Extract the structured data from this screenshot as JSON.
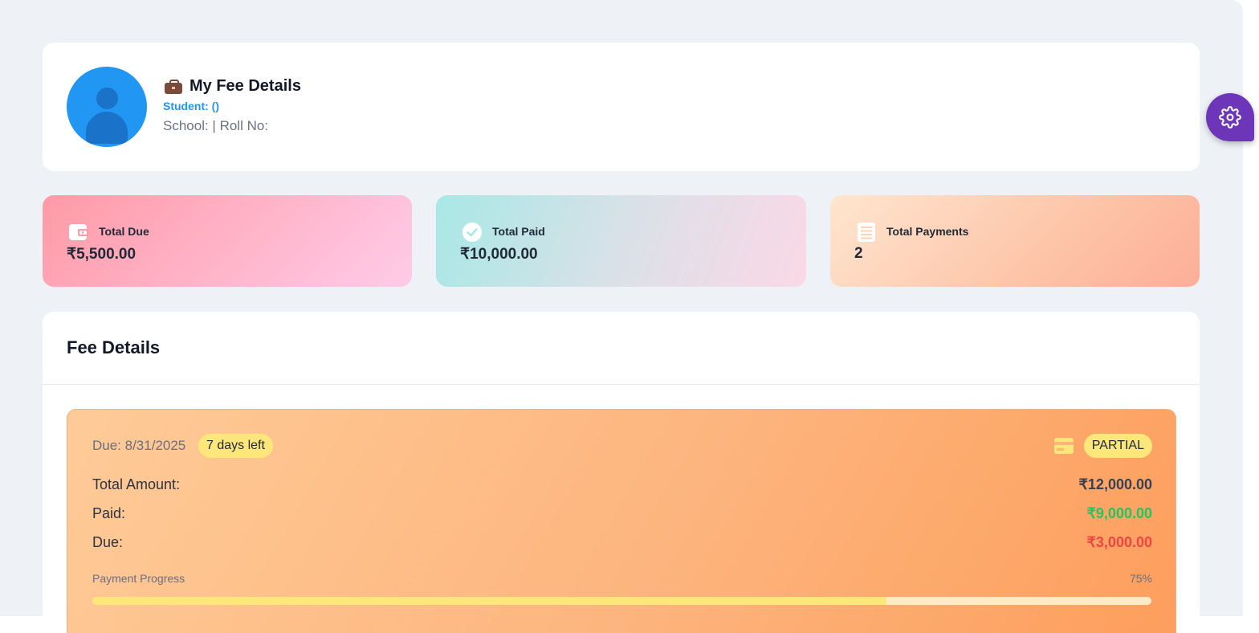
{
  "profile": {
    "title": "My Fee Details",
    "student": "Student: ()",
    "meta": "School: | Roll No:"
  },
  "stats": [
    {
      "label": "Total Due",
      "value": "₹5,500.00",
      "icon": "wallet-icon"
    },
    {
      "label": "Total Paid",
      "value": "₹10,000.00",
      "icon": "check-circle-icon"
    },
    {
      "label": "Total Payments",
      "value": "2",
      "icon": "receipt-icon"
    }
  ],
  "fee_section": {
    "title": "Fee Details",
    "fee": {
      "due_date": "Due: 8/31/2025",
      "days_left": "7 days left",
      "status": "PARTIAL",
      "rows": [
        {
          "label": "Total Amount:",
          "value": "₹12,000.00"
        },
        {
          "label": "Paid:",
          "value": "₹9,000.00"
        },
        {
          "label": "Due:",
          "value": "₹3,000.00"
        }
      ],
      "progress_label": "Payment Progress",
      "progress_text": "75%",
      "progress_value": 0.75
    }
  },
  "colors": {
    "accent_blue": "#2196f3",
    "fab_purple": "#6d35b8",
    "paid_green": "#22c55e",
    "due_red": "#ef4444",
    "badge_yellow": "#fde67a"
  }
}
